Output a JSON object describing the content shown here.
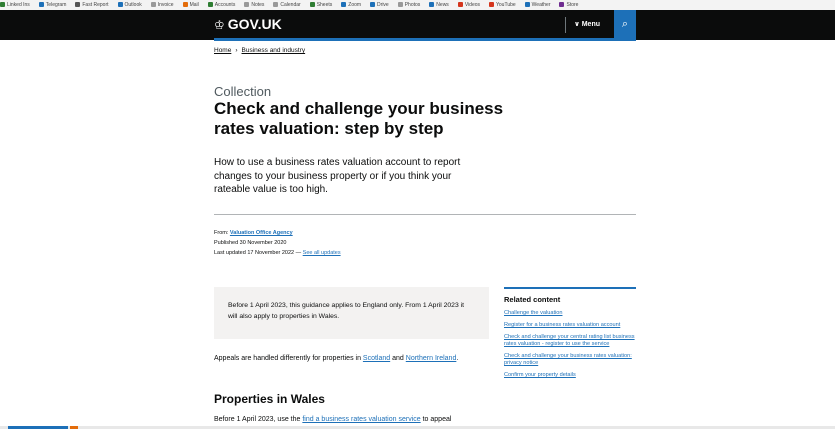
{
  "bookmarks": [
    {
      "label": "Linked Ins",
      "color": "#2e7d32"
    },
    {
      "label": "Telegram",
      "color": "#1d70b8"
    },
    {
      "label": "Fast Report",
      "color": "#555555"
    },
    {
      "label": "Outlook",
      "color": "#1d70b8"
    },
    {
      "label": "Invoice",
      "color": "#999999"
    },
    {
      "label": "Mail",
      "color": "#e36c0a"
    },
    {
      "label": "Accounts",
      "color": "#2e7d32"
    },
    {
      "label": "Notes",
      "color": "#999999"
    },
    {
      "label": "Calendar",
      "color": "#999999"
    },
    {
      "label": "Sheets",
      "color": "#2e7d32"
    },
    {
      "label": "Zoom",
      "color": "#1d70b8"
    },
    {
      "label": "Drive",
      "color": "#1d70b8"
    },
    {
      "label": "Photos",
      "color": "#999999"
    },
    {
      "label": "News",
      "color": "#1d70b8"
    },
    {
      "label": "Videos",
      "color": "#d4351c"
    },
    {
      "label": "YouTube",
      "color": "#d4351c"
    },
    {
      "label": "Weather",
      "color": "#1d70b8"
    },
    {
      "label": "Store",
      "color": "#6f2c91"
    }
  ],
  "header": {
    "logo_text": "GOV.UK",
    "menu_label": "Menu",
    "menu_chevron": "∨",
    "search_icon": "⌕"
  },
  "breadcrumb": {
    "home": "Home",
    "separator": "›",
    "section": "Business and industry"
  },
  "page": {
    "caption": "Collection",
    "title": "Check and challenge your business rates valuation: step by step",
    "lead": "How to use a business rates valuation account to report changes to your business property or if you think your rateable value is too high."
  },
  "meta": {
    "from_label": "From:",
    "from_link": "Valuation Office Agency",
    "published": "Published 30 November 2020",
    "updated_label": "Last updated 17 November 2022 —",
    "updates_link": "See all updates"
  },
  "inset": {
    "text": "Before 1 April 2023, this guidance applies to England only. From 1 April 2023 it will also apply to properties in Wales."
  },
  "appeals": {
    "text_before": "Appeals are handled differently for properties in",
    "link_scotland": "Scotland",
    "text_and": "and",
    "link_ni": "Northern Ireland",
    "text_end": "."
  },
  "wales": {
    "heading": "Properties in Wales",
    "text_before": "Before 1 April 2023, use the",
    "link": "find a business rates valuation service",
    "text_after": "to appeal"
  },
  "related": {
    "heading": "Related content",
    "links": [
      "Challenge the valuation",
      "Register for a business rates valuation account",
      "Check and challenge your central rating list business rates valuation - register to use the service",
      "Check and challenge your business rates valuation: privacy notice",
      "Confirm your property details"
    ]
  }
}
